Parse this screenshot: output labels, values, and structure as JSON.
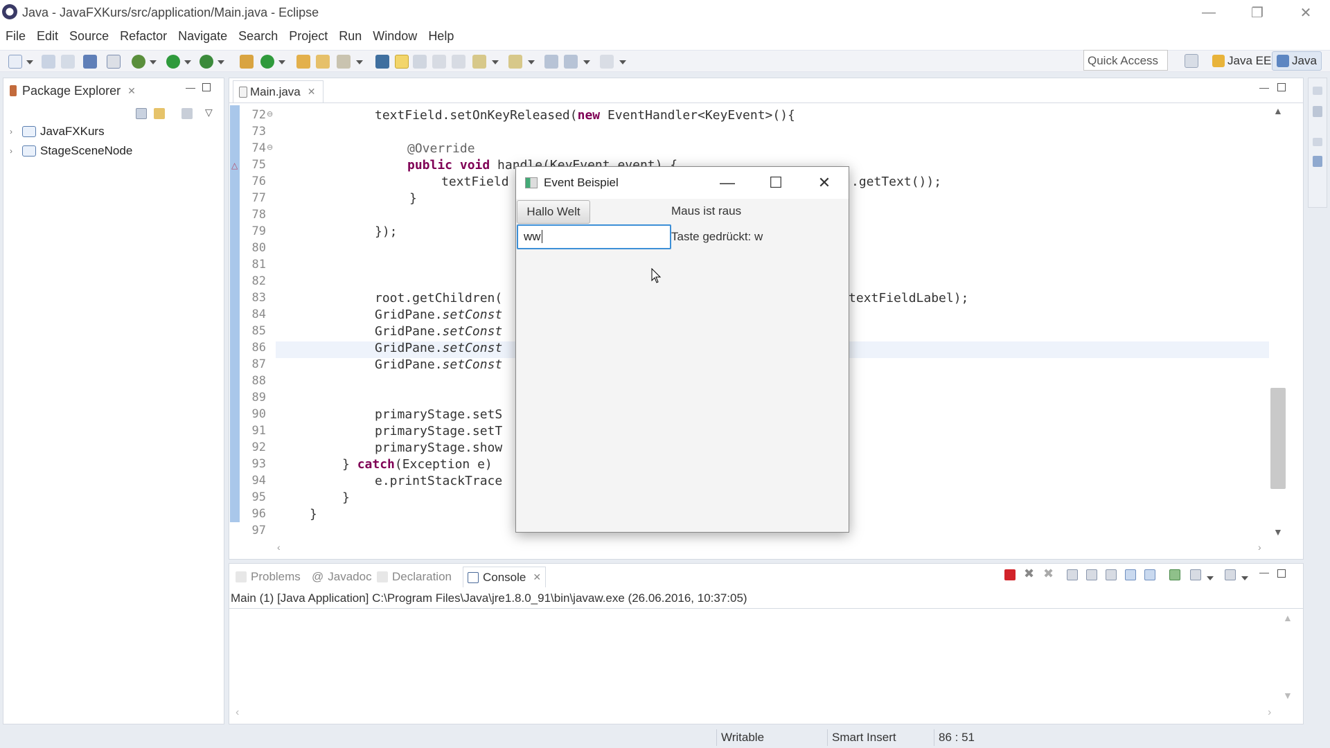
{
  "window": {
    "title": "Java - JavaFXKurs/src/application/Main.java - Eclipse",
    "controls": [
      "—",
      "❐",
      "✕"
    ]
  },
  "menu": [
    "File",
    "Edit",
    "Source",
    "Refactor",
    "Navigate",
    "Search",
    "Project",
    "Run",
    "Window",
    "Help"
  ],
  "toolbar": {
    "quick_access_placeholder": "Quick Access",
    "perspectives": [
      "Java EE",
      "Java"
    ]
  },
  "package_explorer": {
    "tab_label": "Package Explorer",
    "projects": [
      "JavaFXKurs",
      "StageSceneNode"
    ]
  },
  "editor": {
    "tab_label": "Main.java",
    "lines": [
      {
        "n": "72"
      },
      {
        "n": "73"
      },
      {
        "n": "74"
      },
      {
        "n": "75"
      },
      {
        "n": "76"
      },
      {
        "n": "77"
      },
      {
        "n": "78"
      },
      {
        "n": "79"
      },
      {
        "n": "80"
      },
      {
        "n": "81"
      },
      {
        "n": "82"
      },
      {
        "n": "83"
      },
      {
        "n": "84"
      },
      {
        "n": "85"
      },
      {
        "n": "86"
      },
      {
        "n": "87"
      },
      {
        "n": "88"
      },
      {
        "n": "89"
      },
      {
        "n": "90"
      },
      {
        "n": "91"
      },
      {
        "n": "92"
      },
      {
        "n": "93"
      },
      {
        "n": "94"
      },
      {
        "n": "95"
      },
      {
        "n": "96"
      },
      {
        "n": "97"
      }
    ],
    "code": {
      "l72_a": "textField.setOnKeyReleased(",
      "l72_kw": "new",
      "l72_b": " EventHandler<KeyEvent>(){",
      "l74": "@Override",
      "l75_kw": "public void",
      "l75_b": " handle(KeyEvent event) {",
      "l76_a": "textField",
      "l76_b": ".getText());",
      "l77": "}",
      "l79": "});",
      "l83_a": "root.getChildren(",
      "l83_b": "textFieldLabel);",
      "l84_a": "GridPane.",
      "l84_b": "setConst",
      "l90": "primaryStage.setS",
      "l91": "primaryStage.setT",
      "l92": "primaryStage.show",
      "l93_a": "} ",
      "l93_kw": "catch",
      "l93_b": "(Exception e)",
      "l94": "e.printStackTrace",
      "l95": "}",
      "l96": "}"
    }
  },
  "console_panel": {
    "tabs": [
      "Problems",
      "Javadoc",
      "Declaration",
      "Console"
    ],
    "description": "Main (1) [Java Application] C:\\Program Files\\Java\\jre1.8.0_91\\bin\\javaw.exe (26.06.2016, 10:37:05)"
  },
  "status_bar": {
    "mode": "Writable",
    "insert": "Smart Insert",
    "position": "86 : 51"
  },
  "fx_dialog": {
    "title": "Event Beispiel",
    "button_label": "Hallo Welt",
    "mouse_label": "Maus ist raus",
    "textfield_value": "ww",
    "key_label": "Taste gedrückt: w"
  },
  "colors": {
    "keyword": "#7f0055",
    "annotation": "#646464",
    "focus_ring": "#3c8fd7",
    "ruler": "#a9c7ea"
  }
}
